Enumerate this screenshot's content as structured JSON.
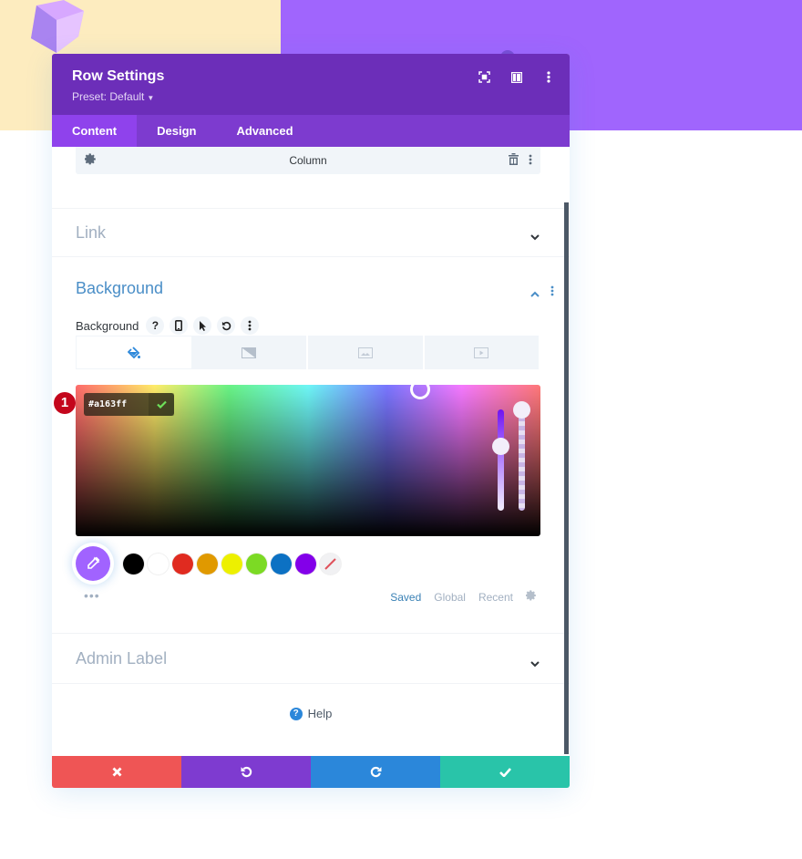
{
  "modal": {
    "title": "Row Settings",
    "preset": "Preset: Default",
    "header_icons": [
      "expand-icon",
      "split-view-icon",
      "more-options-icon"
    ]
  },
  "tabs": [
    {
      "label": "Content",
      "active": true
    },
    {
      "label": "Design",
      "active": false
    },
    {
      "label": "Advanced",
      "active": false
    }
  ],
  "column_bar": {
    "label": "Column"
  },
  "sections": {
    "link": {
      "title": "Link",
      "expanded": false
    },
    "background": {
      "title": "Background",
      "expanded": true
    },
    "admin_label": {
      "title": "Admin Label",
      "expanded": false
    }
  },
  "background_field": {
    "label": "Background",
    "icons": [
      "help-icon",
      "mobile-icon",
      "hover-cursor-icon",
      "reset-icon",
      "more-icon"
    ],
    "type_tabs": [
      {
        "name": "color",
        "active": true
      },
      {
        "name": "gradient",
        "active": false
      },
      {
        "name": "image",
        "active": false
      },
      {
        "name": "video",
        "active": false
      }
    ]
  },
  "color_picker": {
    "hex_value": "#a163ff",
    "step_marker": "1",
    "swatches": [
      "#000000",
      "#ffffff",
      "#e02b20",
      "#e09900",
      "#edf000",
      "#7cda24",
      "#0c71c3",
      "#8300e9"
    ],
    "current_color": "#a163ff",
    "palette_tabs": [
      {
        "label": "Saved",
        "active": true
      },
      {
        "label": "Global",
        "active": false
      },
      {
        "label": "Recent",
        "active": false
      }
    ]
  },
  "help": {
    "label": "Help"
  },
  "footer": {
    "colors": {
      "close": "#ef5555",
      "undo": "#7e3bd0",
      "redo": "#2b87da",
      "save": "#29c4a9"
    }
  }
}
